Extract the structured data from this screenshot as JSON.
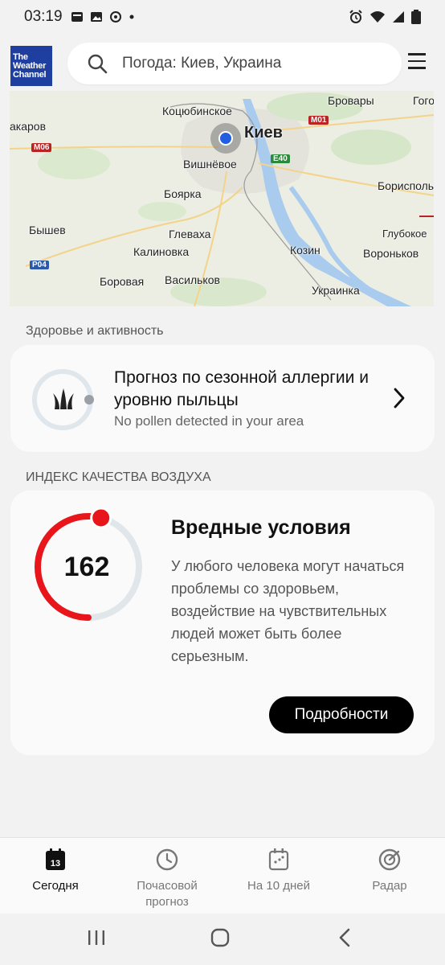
{
  "status_bar": {
    "time": "03:19",
    "icons_left": [
      "sim-card-icon",
      "image-icon",
      "sync-icon",
      "dot-icon"
    ],
    "icons_right": [
      "alarm-icon",
      "wifi-icon",
      "signal-icon",
      "battery-icon"
    ]
  },
  "header": {
    "logo_text": "The Weather Channel",
    "search_placeholder": "Погода: Киев, Украина"
  },
  "map": {
    "labels": {
      "kotsyubynske": "Коцюбинское",
      "brovary": "Бровары",
      "gogoliv": "Гогол",
      "makarov": "акаров",
      "kiev": "Киев",
      "vyshneve": "Вишнёвое",
      "boyarka": "Боярка",
      "boryspil": "Борисполь",
      "byshev": "Бышев",
      "glevakha": "Глеваха",
      "glubokoe": "Глубокое",
      "kalinovka": "Калиновка",
      "kozin": "Козин",
      "voronkov": "Вороньков",
      "borovaya": "Боровая",
      "vasylkiv": "Васильков",
      "ukrainka": "Украинка"
    },
    "roads": {
      "m01": "M01",
      "m06": "M06",
      "e40": "E40",
      "p04": "P04"
    }
  },
  "health": {
    "section_title": "Здоровье и активность",
    "card_title": "Прогноз по сезонной аллергии и уровню пыльцы",
    "card_subtitle": "No pollen detected in your area"
  },
  "air_quality": {
    "section_title": "ИНДЕКС КАЧЕСТВА ВОЗДУХА",
    "value": "162",
    "gauge_fraction": 0.54,
    "status_color": "#e8161b",
    "title": "Вредные условия",
    "description": "У любого человека могут начаться проблемы со здоровьем, воздействие на чувствительных людей может быть более серьезным.",
    "details_button": "Подробности"
  },
  "bottom_nav": {
    "today": "Сегодня",
    "today_day": "13",
    "hourly": "Почасовой прогноз",
    "ten_day": "На 10 дней",
    "radar": "Радар"
  }
}
